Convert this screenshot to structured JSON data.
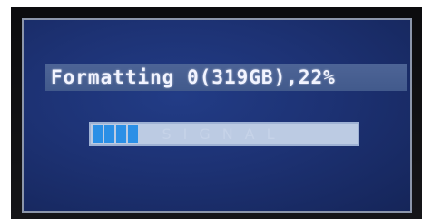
{
  "dialog": {
    "title": "Formatting 0(319GB),22%"
  },
  "progress": {
    "percent": 22,
    "filled_segments": 4,
    "overlay_text": "SIGNAL",
    "fill_color": "#2b8fe6",
    "track_color": "#bccbe3"
  }
}
